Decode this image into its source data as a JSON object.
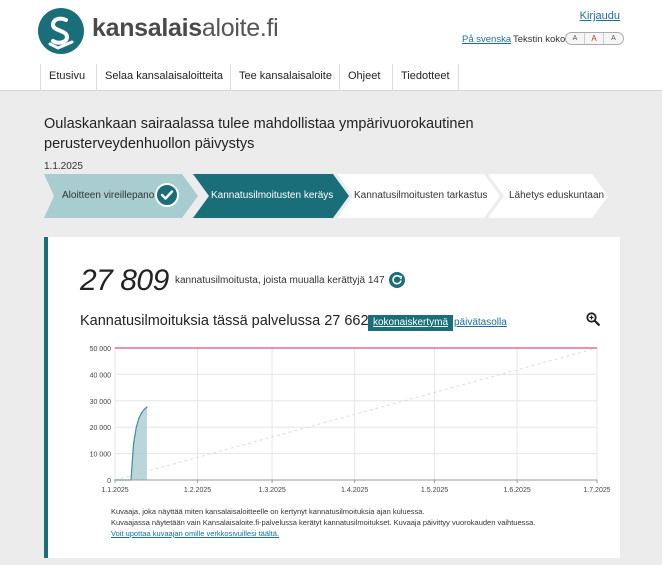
{
  "header": {
    "logo_prefix": "kansalais",
    "logo_suffix": "aloite.fi",
    "login": "Kirjaudu",
    "language_link": "På svenska",
    "text_size_label": "Tekstin koko:",
    "text_size_options": [
      "A",
      "A",
      "A"
    ]
  },
  "nav": {
    "items": [
      "Etusivu",
      "Selaa kansalaisaloitteita",
      "Tee kansalaisaloite",
      "Ohjeet",
      "Tiedotteet"
    ]
  },
  "initiative": {
    "title": "Oulaskankaan sairaalassa tulee mahdollistaa ympärivuorokautinen perusterveydenhuollon päivystys",
    "date": "1.1.2025"
  },
  "steps": [
    {
      "label": "Aloitteen vireillepano",
      "state": "done"
    },
    {
      "label": "Kannatusilmoitusten keräys",
      "state": "active"
    },
    {
      "label": "Kannatusilmoitusten tarkastus",
      "state": "upcoming"
    },
    {
      "label": "Lähetys eduskuntaan",
      "state": "upcoming"
    }
  ],
  "stats": {
    "total": "27 809",
    "description": "kannatusilmoitusta, joista muualla kerättyjä 147",
    "chart_title": "Kannatusilmoituksia tässä palvelussa 27 662",
    "cumulative_button": "kokonaiskertymä",
    "daily_link": "päivätasolla"
  },
  "chart_data": {
    "type": "area",
    "x": [
      "1.1.2025",
      "2.1.2025",
      "3.1.2025",
      "4.1.2025",
      "5.1.2025",
      "6.1.2025",
      "7.1.2025",
      "8.1.2025",
      "9.1.2025",
      "10.1.2025",
      "11.1.2025",
      "12.1.2025",
      "13.1.2025"
    ],
    "values": [
      0,
      0,
      0,
      0,
      0,
      0,
      0,
      14000,
      20000,
      23500,
      25500,
      26800,
      27662
    ],
    "x_tick_labels": [
      "1.1.2025",
      "1.2.2025",
      "1.3.2025",
      "1.4.2025",
      "1.5.2025",
      "1.6.2025",
      "1.7.2025"
    ],
    "y_tick_labels": [
      "0",
      "10 000",
      "20 000",
      "30 000",
      "40 000",
      "50 000"
    ],
    "ylim": [
      0,
      50000
    ],
    "xlim": [
      "1.1.2025",
      "1.7.2025"
    ],
    "goal": 50000,
    "projection": {
      "from": [
        "1.1.2025",
        0
      ],
      "to": [
        "1.7.2025",
        50000
      ]
    },
    "grid": true,
    "colors": {
      "area": "#aecfd3",
      "line": "#3f8f98",
      "goal": "#e0507a",
      "projection": "#dddddd"
    }
  },
  "caption": {
    "line1": "Kuvaaja, joka näyttää miten kansalaisaloitteelle on kertynyt kannatusilmoituksia ajan kuluessa.",
    "line2": "Kuvaajassa näytetään vain Kansalaisaloite.fi-palvelussa kerätyt kannatusilmoitukset. Kuvaaja päivittyy vuorokauden vaihtuessa.",
    "embed_link": "Voit upottaa kuvaajan omille verkkosivuillesi täältä."
  },
  "colors": {
    "brand": "#1a6e7a",
    "link": "#1a6ea0"
  }
}
